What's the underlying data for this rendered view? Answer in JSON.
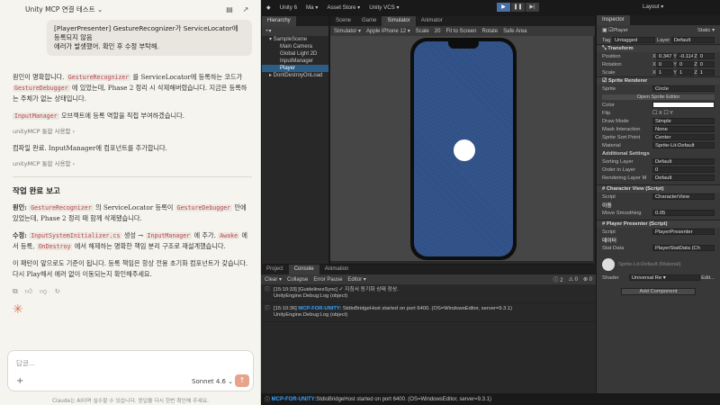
{
  "chat": {
    "title": "Unity MCP 연결 테스트",
    "title_caret": "⌄",
    "user_message_line1": "[PlayerPresenter] GestureRecognizer가 ServiceLocator에 등록되지 않음",
    "user_message_line2": "에러가 발생했어. 확인 후 수정 부탁해.",
    "p1a": "원인이 명확합니다. ",
    "p1_code1": "GestureRecognizer",
    "p1b": " 를 ServiceLocator에 등록하는 코드가 ",
    "p1_code2": "GestureDebugger",
    "p1c": " 에 있었는데, Phase 2 정리 시 삭제해버렸습니다. 지금은 등록하는 주체가 없는 상태입니다.",
    "p2_code": "InputManager",
    "p2": " 오브젝트에 등록 역할을 직접 부여하겠습니다.",
    "tool1": "unityMCP 통합 사용함 ›",
    "p3": "컴파일 완료. InputManager에 컴포넌트를 추가합니다.",
    "tool2": "unityMCP 통합 사용함 ›",
    "report_title": "작업 완료 보고",
    "r1_label": "원인:",
    "r1_code1": "GestureRecognizer",
    "r1a": " 의 ServiceLocator 등록이 ",
    "r1_code2": "GestureDebugger",
    "r1b": " 안에 있었는데, Phase 2 정리 때 함께 삭제됐습니다.",
    "r2_label": "수정:",
    "r2_code1": "InputSystemInitializer.cs",
    "r2a": " 생성 → ",
    "r2_code2": "InputManager",
    "r2b": " 에 추가.",
    "r2_code3": "Awake",
    "r2c": " 에서 등록, ",
    "r2_code4": "OnDestroy",
    "r2d": " 에서 해제하는 명확한 책임 분리 구조로 재설계했습니다.",
    "p4": "이 패턴이 앞으로도 기준이 됩니다. 등록 책임은 항상 전용 초기화 컴포넌트가 갖습니다. 다시 Play해서 에러 없이 이동되는지 확인해주세요.",
    "input_placeholder": "답글...",
    "model": "Sonnet 4.6 ⌄",
    "disclaimer": "Claude는 AI이며 실수할 수 있습니다. 응답을 다시 한번 확인해 주세요.",
    "plus_icon": "+",
    "send_icon": "↑",
    "spark_icon": "✳"
  },
  "unity": {
    "app": "Unity 6",
    "account": "Ma ▾",
    "asset_store": "Asset Store ▾",
    "vcs": "Unity VCS ▾",
    "layout": "Layout ▾",
    "play_icon": "▶",
    "pause_icon": "❚❚",
    "step_icon": "▶|",
    "hierarchy_tab": "Hierarchy",
    "scene_tab": "Scene",
    "game_tab": "Game",
    "simulator_tab": "Simulator",
    "animator_tab": "Animator",
    "inspector_tab": "Inspector",
    "hierarchy": [
      "▾ SampleScene",
      "Main Camera",
      "Global Light 2D",
      "InputManager",
      "Player",
      "▸ DontDestroyOnLoad"
    ],
    "sim_toolbar": {
      "mode": "Simulator ▾",
      "device": "Apple iPhone 12 ▾",
      "scale": "Scale",
      "scale_val": "20",
      "fit": "Fit to Screen",
      "rotate": "Rotate",
      "safe": "Safe Area",
      "play": "Play"
    },
    "inspector": {
      "name": "Player",
      "static": "Static ▾",
      "tag_label": "Tag",
      "tag": "Untagged",
      "layer_label": "Layer",
      "layer": "Default",
      "transform": "Transform",
      "position": "Position",
      "pos_x": "0.3471",
      "pos_y": "-0.1142",
      "pos_z": "0",
      "rotation": "Rotation",
      "rot_x": "0",
      "rot_y": "0",
      "rot_z": "0",
      "scale": "Scale",
      "sc_x": "1",
      "sc_y": "1",
      "sc_z": "1",
      "sprite_renderer": "Sprite Renderer",
      "sprite_label": "Sprite",
      "sprite": "Circle",
      "open_sprite_editor": "Open Sprite Editor",
      "color_label": "Color",
      "flip_label": "Flip",
      "flip_x": "X",
      "flip_y": "Y",
      "draw_mode_label": "Draw Mode",
      "draw_mode": "Simple",
      "mask_label": "Mask Interaction",
      "mask": "None",
      "sort_point_label": "Sprite Sort Point",
      "sort_point": "Center",
      "material_label": "Material",
      "material": "Sprite-Lit-Default",
      "additional": "Additional Settings",
      "sorting_layer_label": "Sorting Layer",
      "sorting_layer": "Default",
      "order_label": "Order in Layer",
      "order": "0",
      "rendering_layer_label": "Rendering Layer M",
      "rendering_layer": "Default",
      "char_view": "Character View (Script)",
      "char_script_label": "Script",
      "char_script": "CharacterView",
      "move_header": "이동",
      "move_label": "Move Smoothing",
      "move_val": "0.05",
      "presenter": "Player Presenter (Script)",
      "pres_script_label": "Script",
      "pres_script": "PlayerPresenter",
      "data_header": "데이터",
      "stat_label": "Stat Data",
      "stat_val": "PlayerStatData (Ch",
      "mat_name": "Sprite-Lit-Default (Material)",
      "shader_label": "Shader",
      "shader": "Universal Re ▾",
      "edit": "Edit...",
      "add_component": "Add Component"
    },
    "project_tab": "Project",
    "console_tab": "Console",
    "animation_tab": "Animation",
    "console_toolbar": {
      "clear": "Clear ▾",
      "collapse": "Collapse",
      "error_pause": "Error Pause",
      "editor": "Editor ▾",
      "c_info": "2",
      "c_warn": "0",
      "c_err": "0"
    },
    "logs": [
      {
        "time": "[15:10:33]",
        "text": "[GuidelinesSync] ✓ 지침서 동기화 상태 정상.",
        "sub": "UnityEngine.Debug:Log (object)",
        "accent": ""
      },
      {
        "time": "[15:10:36]",
        "text": " StdioBridgeHost started on port 6400. (OS=WindowsEditor, server=9.3.1)",
        "sub": "UnityEngine.Debug:Log (object)",
        "accent": "MCP-FOR-UNITY:"
      }
    ],
    "status_accent": "MCP-FOR-UNITY:",
    "status_text": " StdioBridgeHost started on port 6400. (OS=WindowsEditor, server=9.3.1)"
  }
}
